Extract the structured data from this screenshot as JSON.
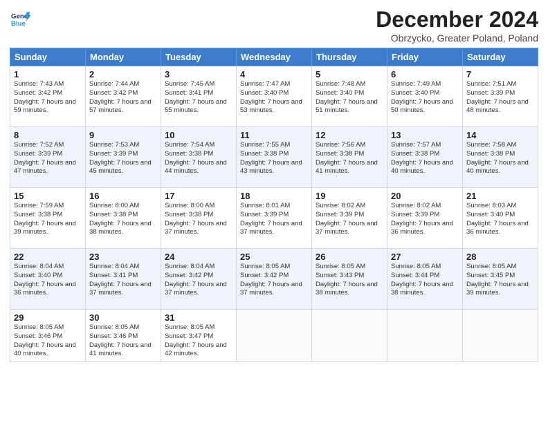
{
  "header": {
    "logo_line1": "General",
    "logo_line2": "Blue",
    "month_title": "December 2024",
    "location": "Obrzycko, Greater Poland, Poland"
  },
  "days_of_week": [
    "Sunday",
    "Monday",
    "Tuesday",
    "Wednesday",
    "Thursday",
    "Friday",
    "Saturday"
  ],
  "weeks": [
    [
      {
        "day": "1",
        "sunrise": "7:43 AM",
        "sunset": "3:42 PM",
        "daylight": "7 hours and 59 minutes."
      },
      {
        "day": "2",
        "sunrise": "7:44 AM",
        "sunset": "3:42 PM",
        "daylight": "7 hours and 57 minutes."
      },
      {
        "day": "3",
        "sunrise": "7:45 AM",
        "sunset": "3:41 PM",
        "daylight": "7 hours and 55 minutes."
      },
      {
        "day": "4",
        "sunrise": "7:47 AM",
        "sunset": "3:40 PM",
        "daylight": "7 hours and 53 minutes."
      },
      {
        "day": "5",
        "sunrise": "7:48 AM",
        "sunset": "3:40 PM",
        "daylight": "7 hours and 51 minutes."
      },
      {
        "day": "6",
        "sunrise": "7:49 AM",
        "sunset": "3:40 PM",
        "daylight": "7 hours and 50 minutes."
      },
      {
        "day": "7",
        "sunrise": "7:51 AM",
        "sunset": "3:39 PM",
        "daylight": "7 hours and 48 minutes."
      }
    ],
    [
      {
        "day": "8",
        "sunrise": "7:52 AM",
        "sunset": "3:39 PM",
        "daylight": "7 hours and 47 minutes."
      },
      {
        "day": "9",
        "sunrise": "7:53 AM",
        "sunset": "3:39 PM",
        "daylight": "7 hours and 45 minutes."
      },
      {
        "day": "10",
        "sunrise": "7:54 AM",
        "sunset": "3:38 PM",
        "daylight": "7 hours and 44 minutes."
      },
      {
        "day": "11",
        "sunrise": "7:55 AM",
        "sunset": "3:38 PM",
        "daylight": "7 hours and 43 minutes."
      },
      {
        "day": "12",
        "sunrise": "7:56 AM",
        "sunset": "3:38 PM",
        "daylight": "7 hours and 41 minutes."
      },
      {
        "day": "13",
        "sunrise": "7:57 AM",
        "sunset": "3:38 PM",
        "daylight": "7 hours and 40 minutes."
      },
      {
        "day": "14",
        "sunrise": "7:58 AM",
        "sunset": "3:38 PM",
        "daylight": "7 hours and 40 minutes."
      }
    ],
    [
      {
        "day": "15",
        "sunrise": "7:59 AM",
        "sunset": "3:38 PM",
        "daylight": "7 hours and 39 minutes."
      },
      {
        "day": "16",
        "sunrise": "8:00 AM",
        "sunset": "3:38 PM",
        "daylight": "7 hours and 38 minutes."
      },
      {
        "day": "17",
        "sunrise": "8:00 AM",
        "sunset": "3:38 PM",
        "daylight": "7 hours and 37 minutes."
      },
      {
        "day": "18",
        "sunrise": "8:01 AM",
        "sunset": "3:39 PM",
        "daylight": "7 hours and 37 minutes."
      },
      {
        "day": "19",
        "sunrise": "8:02 AM",
        "sunset": "3:39 PM",
        "daylight": "7 hours and 37 minutes."
      },
      {
        "day": "20",
        "sunrise": "8:02 AM",
        "sunset": "3:39 PM",
        "daylight": "7 hours and 36 minutes."
      },
      {
        "day": "21",
        "sunrise": "8:03 AM",
        "sunset": "3:40 PM",
        "daylight": "7 hours and 36 minutes."
      }
    ],
    [
      {
        "day": "22",
        "sunrise": "8:04 AM",
        "sunset": "3:40 PM",
        "daylight": "7 hours and 36 minutes."
      },
      {
        "day": "23",
        "sunrise": "8:04 AM",
        "sunset": "3:41 PM",
        "daylight": "7 hours and 37 minutes."
      },
      {
        "day": "24",
        "sunrise": "8:04 AM",
        "sunset": "3:42 PM",
        "daylight": "7 hours and 37 minutes."
      },
      {
        "day": "25",
        "sunrise": "8:05 AM",
        "sunset": "3:42 PM",
        "daylight": "7 hours and 37 minutes."
      },
      {
        "day": "26",
        "sunrise": "8:05 AM",
        "sunset": "3:43 PM",
        "daylight": "7 hours and 38 minutes."
      },
      {
        "day": "27",
        "sunrise": "8:05 AM",
        "sunset": "3:44 PM",
        "daylight": "7 hours and 38 minutes."
      },
      {
        "day": "28",
        "sunrise": "8:05 AM",
        "sunset": "3:45 PM",
        "daylight": "7 hours and 39 minutes."
      }
    ],
    [
      {
        "day": "29",
        "sunrise": "8:05 AM",
        "sunset": "3:46 PM",
        "daylight": "7 hours and 40 minutes."
      },
      {
        "day": "30",
        "sunrise": "8:05 AM",
        "sunset": "3:46 PM",
        "daylight": "7 hours and 41 minutes."
      },
      {
        "day": "31",
        "sunrise": "8:05 AM",
        "sunset": "3:47 PM",
        "daylight": "7 hours and 42 minutes."
      },
      null,
      null,
      null,
      null
    ]
  ],
  "labels": {
    "sunrise": "Sunrise:",
    "sunset": "Sunset:",
    "daylight": "Daylight:"
  }
}
